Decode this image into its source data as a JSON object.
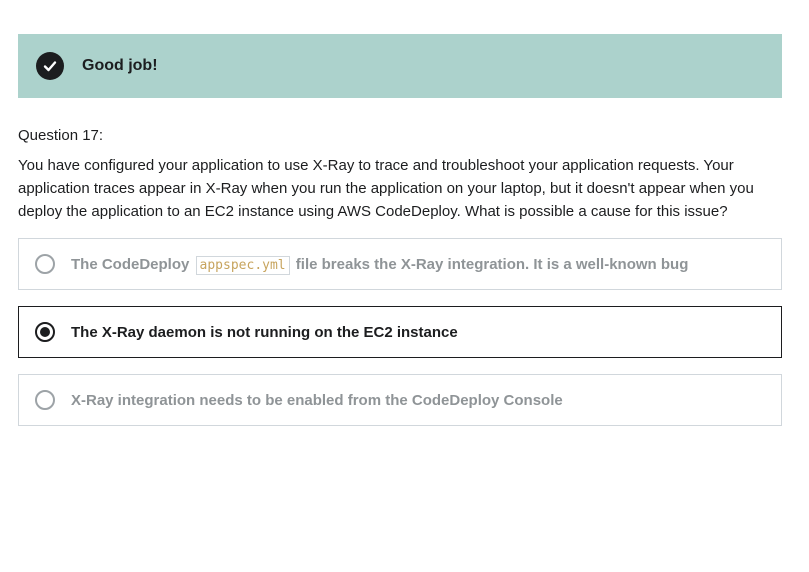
{
  "banner": {
    "icon": "checkmark-icon",
    "message": "Good job!",
    "background": "#acd2cc"
  },
  "question": {
    "label": "Question 17:",
    "text": "You have configured your application to use X-Ray to trace and troubleshoot your application requests. Your application traces appear in X-Ray when you run the application on your laptop, but it doesn't appear when you deploy the application to an EC2 instance using AWS CodeDeploy. What is possible a cause for this issue?"
  },
  "options": [
    {
      "text_before": "The CodeDeploy",
      "code": "appspec.yml",
      "text_after": "file breaks the X-Ray integration. It is a well-known bug",
      "selected": false
    },
    {
      "text": "The X-Ray daemon is not running on the EC2 instance",
      "selected": true
    },
    {
      "text": "X-Ray integration needs to be enabled from the CodeDeploy Console",
      "selected": false
    }
  ]
}
